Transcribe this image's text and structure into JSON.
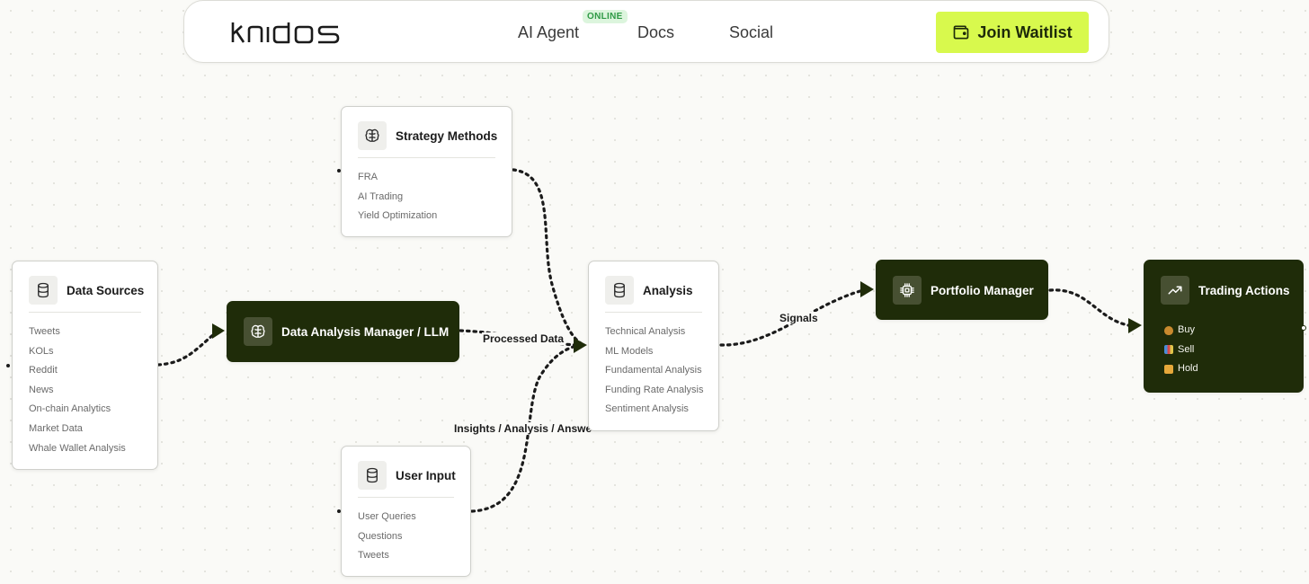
{
  "header": {
    "logo_text": "knidos",
    "nav": [
      {
        "label": "AI Agent",
        "badge": "ONLINE"
      },
      {
        "label": "Docs"
      },
      {
        "label": "Social"
      }
    ],
    "cta_label": "Join Waitlist",
    "accent_color": "#d8f94d",
    "badge_color": "#2f9a45"
  },
  "nodes": {
    "strategy": {
      "title": "Strategy Methods",
      "icon": "brain-icon",
      "items": [
        "FRA",
        "AI Trading",
        "Yield Optimization"
      ]
    },
    "data_sources": {
      "title": "Data Sources",
      "icon": "database-icon",
      "items": [
        "Tweets",
        "KOLs",
        "Reddit",
        "News",
        "On-chain Analytics",
        "Market Data",
        "Whale Wallet Analysis"
      ]
    },
    "llm": {
      "title": "Data Analysis Manager / LLM",
      "icon": "brain-icon"
    },
    "analysis": {
      "title": "Analysis",
      "icon": "database-icon",
      "items": [
        "Technical Analysis",
        "ML Models",
        "Fundamental Analysis",
        "Funding Rate Analysis",
        "Sentiment Analysis"
      ]
    },
    "user_input": {
      "title": "User Input",
      "icon": "database-icon",
      "items": [
        "User Queries",
        "Questions",
        "Tweets"
      ]
    },
    "portfolio": {
      "title": "Portfolio Manager",
      "icon": "cpu-chip-icon"
    },
    "trading": {
      "title": "Trading Actions",
      "icon": "trending-up-icon",
      "items": [
        "Buy",
        "Sell",
        "Hold"
      ],
      "item_icons": [
        "money-bag-icon",
        "bar-chart-icon",
        "handshake-icon"
      ]
    }
  },
  "edges": [
    {
      "from": "data_sources",
      "to": "llm",
      "label": ""
    },
    {
      "from": "llm",
      "to": "analysis",
      "label": "Processed Data"
    },
    {
      "from": "strategy",
      "to": "analysis",
      "label": ""
    },
    {
      "from": "user_input",
      "to": "analysis",
      "label": "Insights / Analysis / Answe"
    },
    {
      "from": "analysis",
      "to": "portfolio",
      "label": "Signals"
    },
    {
      "from": "portfolio",
      "to": "trading",
      "label": ""
    }
  ],
  "colors": {
    "dark_node": "#1f2c09",
    "edge": "#1b1b1b"
  }
}
